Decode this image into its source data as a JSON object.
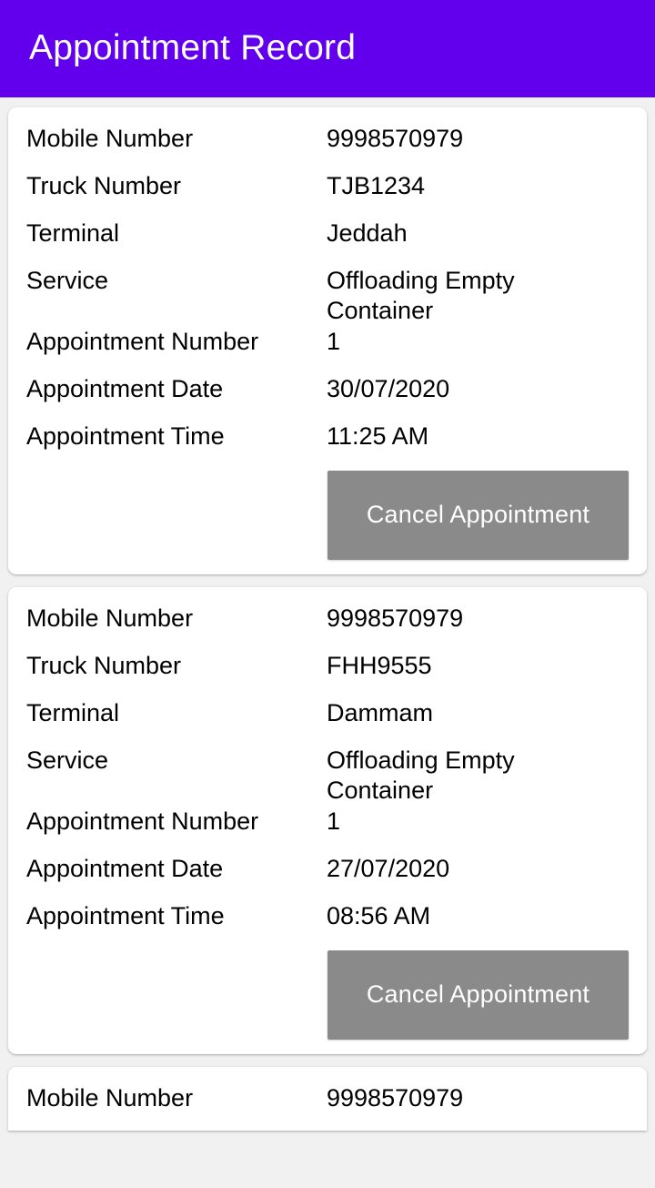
{
  "appbar": {
    "title": "Appointment Record",
    "background_color": "#6200EE",
    "title_color": "#FFFFFF"
  },
  "theme": {
    "page_background": "#F1F1F1",
    "card_background": "#FFFFFF",
    "text_color": "#000000",
    "button_color": "#8A8A8A",
    "button_text_color": "#FFFFFF"
  },
  "labels": {
    "mobile_number": "Mobile Number",
    "truck_number": "Truck Number",
    "terminal": "Terminal",
    "service": "Service",
    "appointment_number": "Appointment Number",
    "appointment_date": "Appointment Date",
    "appointment_time": "Appointment Time"
  },
  "buttons": {
    "cancel_appointment": "Cancel Appointment"
  },
  "records": [
    {
      "mobile_number": "9998570979",
      "truck_number": "TJB1234",
      "terminal": "Jeddah",
      "service": "Offloading Empty Container",
      "appointment_number": "1",
      "appointment_date": "30/07/2020",
      "appointment_time": "11:25 AM"
    },
    {
      "mobile_number": "9998570979",
      "truck_number": "FHH9555",
      "terminal": "Dammam",
      "service": "Offloading Empty Container",
      "appointment_number": "1",
      "appointment_date": "27/07/2020",
      "appointment_time": "08:56 AM"
    },
    {
      "mobile_number": "9998570979"
    }
  ]
}
